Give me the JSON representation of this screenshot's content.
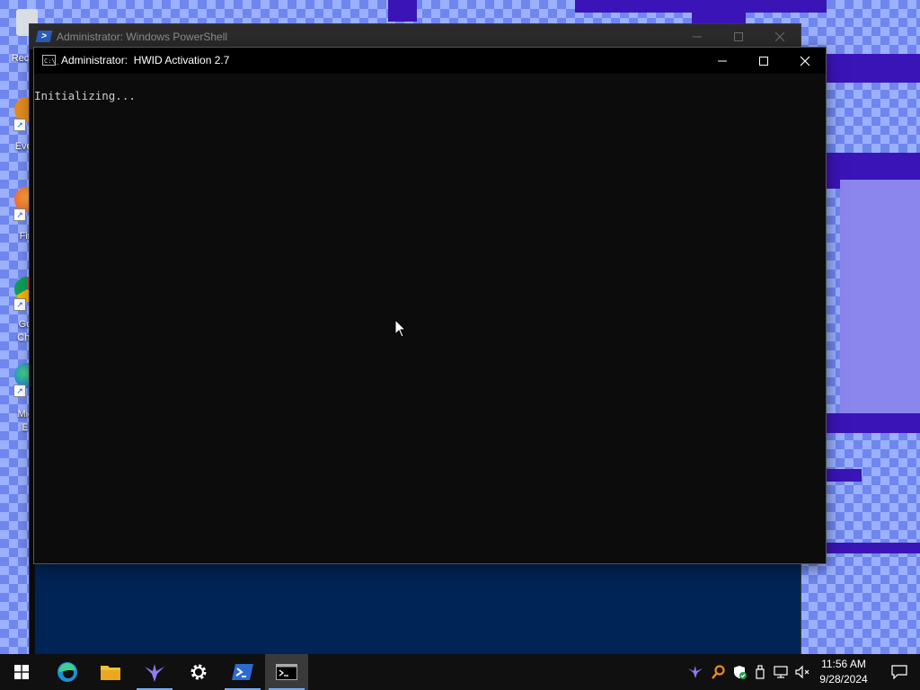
{
  "desktop": {
    "icons": [
      {
        "label": "Recyc",
        "icon": "recycle-bin-icon"
      },
      {
        "label": "Ever",
        "icon": "everything-icon"
      },
      {
        "label": "Fir",
        "icon": "firefox-icon"
      },
      {
        "label": "Go\nChr",
        "icon": "chrome-icon"
      },
      {
        "label": "Mic\nE",
        "icon": "edge-icon"
      }
    ]
  },
  "ps_window": {
    "title": "Administrator: Windows PowerShell"
  },
  "cmd_window": {
    "title": "Administrator:  HWID Activation 2.7",
    "lines": [
      "Initializing..."
    ]
  },
  "taskbar": {
    "items": [
      {
        "name": "start-button",
        "icon": "windows-logo-icon"
      },
      {
        "name": "edge",
        "icon": "edge-icon"
      },
      {
        "name": "file-explorer",
        "icon": "folder-icon"
      },
      {
        "name": "app-bird",
        "icon": "bird-icon"
      },
      {
        "name": "settings",
        "icon": "gear-icon"
      },
      {
        "name": "powershell",
        "icon": "powershell-icon"
      },
      {
        "name": "cmd",
        "icon": "cmd-icon",
        "active": true
      }
    ],
    "tray": [
      "bird-icon",
      "search-icon",
      "shield-icon",
      "usb-icon",
      "network-icon",
      "volume-muted-icon"
    ],
    "clock": {
      "time": "11:56 AM",
      "date": "9/28/2024"
    }
  },
  "colors": {
    "ps_background": "#012456",
    "cmd_background": "#0c0c0c",
    "taskbar": "#101010",
    "desktop_purple": "#3b14b8"
  }
}
